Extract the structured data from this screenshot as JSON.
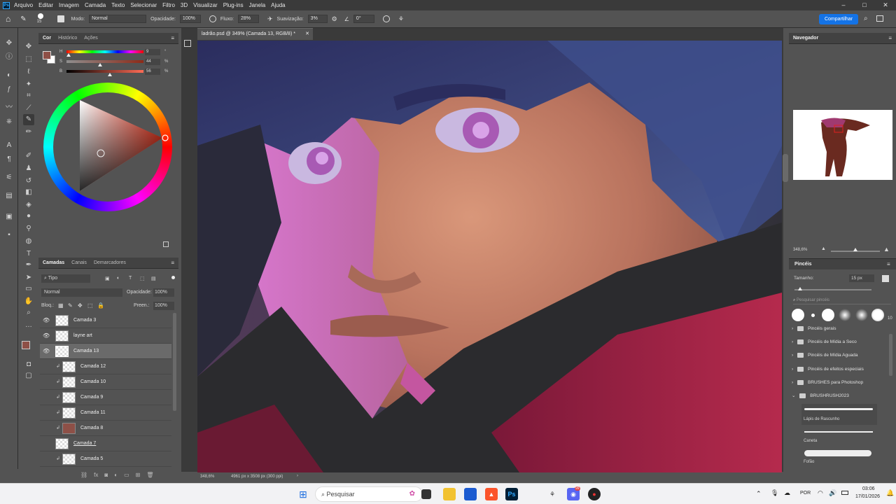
{
  "menu": [
    "Arquivo",
    "Editar",
    "Imagem",
    "Camada",
    "Texto",
    "Selecionar",
    "Filtro",
    "3D",
    "Visualizar",
    "Plug-ins",
    "Janela",
    "Ajuda"
  ],
  "window_controls": {
    "minimize": "–",
    "maximize": "□",
    "close": "✕"
  },
  "options": {
    "brush_size": "15",
    "mode_label": "Modo:",
    "mode_value": "Normal",
    "opacity_label": "Opacidade:",
    "opacity_value": "100%",
    "flow_label": "Fluxo:",
    "flow_value": "28%",
    "smoothing_label": "Suavização:",
    "smoothing_value": "3%",
    "angle_value": "0°",
    "share_label": "Compartilhar"
  },
  "color_panel": {
    "tabs": [
      "Cor",
      "Histórico",
      "Ações"
    ],
    "sliders": [
      {
        "label": "H",
        "value": "9",
        "unit": "°",
        "fraction": 0.025
      },
      {
        "label": "S",
        "value": "44",
        "unit": "%",
        "fraction": 0.44
      },
      {
        "label": "B",
        "value": "56",
        "unit": "%",
        "fraction": 0.56
      }
    ],
    "foreground_color": "#8e5047",
    "background_color": "#ffffff"
  },
  "layers_panel": {
    "tabs": [
      "Camadas",
      "Canais",
      "Demarcadores"
    ],
    "filter_label": "Tipo",
    "blend_mode": "Normal",
    "opacity_label": "Opacidade:",
    "opacity_value": "100%",
    "lock_label": "Bloq.:",
    "fill_label": "Preen.:",
    "fill_value": "100%",
    "layers": [
      {
        "name": "Camada 3",
        "visible": true,
        "clipped": false,
        "selected": false
      },
      {
        "name": "layne art",
        "visible": true,
        "clipped": false,
        "selected": false
      },
      {
        "name": "Camada 13",
        "visible": true,
        "clipped": false,
        "selected": true
      },
      {
        "name": "Camada 12",
        "visible": false,
        "clipped": true,
        "selected": false
      },
      {
        "name": "Camada 10",
        "visible": false,
        "clipped": true,
        "selected": false
      },
      {
        "name": "Camada 9",
        "visible": false,
        "clipped": true,
        "selected": false
      },
      {
        "name": "Camada 11",
        "visible": false,
        "clipped": true,
        "selected": false
      },
      {
        "name": "Camada 8",
        "visible": false,
        "clipped": true,
        "selected": false
      },
      {
        "name": "Camada 7",
        "visible": false,
        "clipped": false,
        "selected": false
      },
      {
        "name": "Camada 5",
        "visible": false,
        "clipped": true,
        "selected": false
      }
    ]
  },
  "document": {
    "tab_title": "ladrão.psd @ 349% (Camada 13, RGB/8) *",
    "zoom": "348,6%",
    "info": "4961 px x 3508 px (300 ppi)"
  },
  "navigator": {
    "title": "Navegador",
    "zoom": "348,6%"
  },
  "brushes": {
    "title": "Pincéis",
    "size_label": "Tamanho:",
    "size_value": "15 px",
    "search_placeholder": "Pesquisar pincéis",
    "preset_count": "10",
    "folders": [
      "Pincéis gerais",
      "Pincéis de Mídia a Seco",
      "Pincéis de Mídia Aguada",
      "Pincéis de efeitos especiais",
      "BRUSHES para Photoshop",
      "BRUSHRUSH2023"
    ],
    "items": [
      "Lápis de Rascunho",
      "Caneta",
      "Fofão"
    ]
  },
  "taskbar": {
    "search_placeholder": "Pesquisar",
    "language": "POR",
    "time": "03:06",
    "date": "17/01/2026",
    "discord_badge": "99"
  }
}
